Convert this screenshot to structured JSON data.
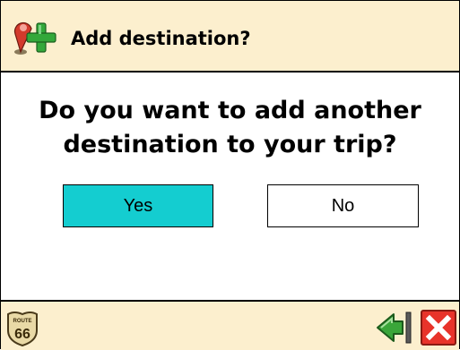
{
  "dialog": {
    "title": "Add destination?",
    "title_icon": "map-pin-plus-icon",
    "question_line1": "Do you want to add another",
    "question_line2": "destination to your trip?",
    "yes_label": "Yes",
    "no_label": "No"
  },
  "footer": {
    "route_badge_top": "ROUTE",
    "route_badge_number": "66",
    "back_icon": "back-arrow-icon",
    "close_icon": "close-icon"
  },
  "colors": {
    "header_bg": "#fcefce",
    "yes_bg": "#14cdd0",
    "close_red": "#e8332a",
    "back_green": "#3aa63a"
  }
}
